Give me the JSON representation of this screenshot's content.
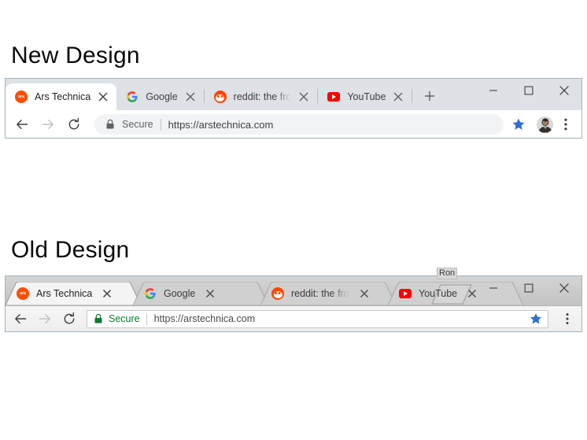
{
  "headings": {
    "new": "New Design",
    "old": "Old Design"
  },
  "colors": {
    "accent_blue": "#1a73e8",
    "star_blue": "#2f6fd0",
    "secure_green": "#0b7c2f",
    "secure_grey": "#5f6368",
    "tabstrip_new": "#dee1e6",
    "tabstrip_old": "#c8c8c8",
    "omnibox_new": "#f1f3f4",
    "ars_orange": "#ff4e00",
    "reddit_orange": "#ff4500",
    "youtube_red": "#ff0000"
  },
  "new_design": {
    "tabs": [
      {
        "title": "Ars Technica",
        "favicon": "ars-technica-favicon",
        "active": true,
        "close_label": "×"
      },
      {
        "title": "Google",
        "favicon": "google-favicon",
        "active": false,
        "close_label": "×"
      },
      {
        "title": "reddit: the fro",
        "favicon": "reddit-favicon",
        "active": false,
        "close_label": "×"
      },
      {
        "title": "YouTube",
        "favicon": "youtube-favicon",
        "active": false,
        "close_label": "×"
      }
    ],
    "new_tab_label": "+",
    "window_controls": {
      "minimize": "—",
      "maximize": "□",
      "close": "✕"
    },
    "toolbar": {
      "back_label": "←",
      "forward_label": "→",
      "reload_label": "↻",
      "security_text": "Secure",
      "url": "https://arstechnica.com",
      "bookmark_label": "★",
      "menu_label": "⋮"
    }
  },
  "old_design": {
    "tabs": [
      {
        "title": "Ars Technica",
        "favicon": "ars-technica-favicon",
        "active": true,
        "close_label": "×"
      },
      {
        "title": "Google",
        "favicon": "google-favicon",
        "active": false,
        "close_label": "×"
      },
      {
        "title": "reddit: the fro",
        "favicon": "reddit-favicon",
        "active": false,
        "close_label": "×"
      },
      {
        "title": "YouTube",
        "favicon": "youtube-favicon",
        "active": false,
        "close_label": "×"
      }
    ],
    "profile_name": "Ron",
    "window_controls": {
      "minimize": "—",
      "maximize": "□",
      "close": "✕"
    },
    "toolbar": {
      "back_label": "←",
      "forward_label": "→",
      "reload_label": "↻",
      "security_text": "Secure",
      "url": "https://arstechnica.com",
      "bookmark_label": "★",
      "menu_label": "⋮"
    }
  }
}
